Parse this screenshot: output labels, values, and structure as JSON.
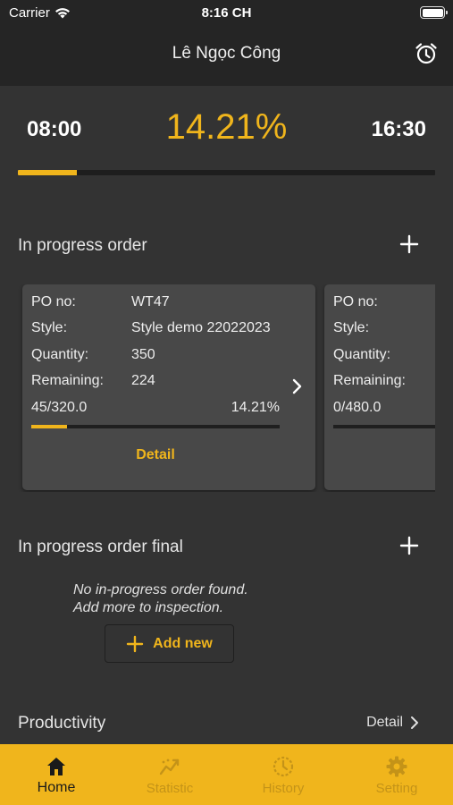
{
  "status_bar": {
    "carrier": "Carrier",
    "time": "8:16 CH"
  },
  "nav": {
    "title": "Lê Ngọc Công",
    "alarm_icon": "alarm-clock-icon"
  },
  "timer": {
    "start": "08:00",
    "percent": "14.21%",
    "end": "16:30",
    "progress": 0.1421,
    "accent": "#f0b51c"
  },
  "in_progress": {
    "heading": "In progress order",
    "cards": [
      {
        "po_label": "PO no:",
        "po": "WT47",
        "style_label": "Style:",
        "style": "Style demo 22022023",
        "qty_label": "Quantity:",
        "qty": "350",
        "rem_label": "Remaining:",
        "rem": "224",
        "ratio": "45/320.0",
        "pct": "14.21%",
        "progress": 0.1421,
        "detail": "Detail"
      },
      {
        "po_label": "PO no:",
        "po": "",
        "style_label": "Style:",
        "style": "",
        "qty_label": "Quantity:",
        "qty": "",
        "rem_label": "Remaining:",
        "rem": "",
        "ratio": "0/480.0",
        "pct": "",
        "progress": 0,
        "detail": ""
      }
    ]
  },
  "in_progress_final": {
    "heading": "In progress order final",
    "empty_line1": "No in-progress order found.",
    "empty_line2": "Add more to inspection.",
    "add_new": "Add new"
  },
  "productivity": {
    "heading": "Productivity",
    "detail": "Detail"
  },
  "tabs": [
    {
      "label": "Home",
      "icon": "home-icon",
      "active": true
    },
    {
      "label": "Statistic",
      "icon": "chart-line-icon",
      "active": false
    },
    {
      "label": "History",
      "icon": "clock-history-icon",
      "active": false
    },
    {
      "label": "Setting",
      "icon": "gear-icon",
      "active": false
    }
  ]
}
